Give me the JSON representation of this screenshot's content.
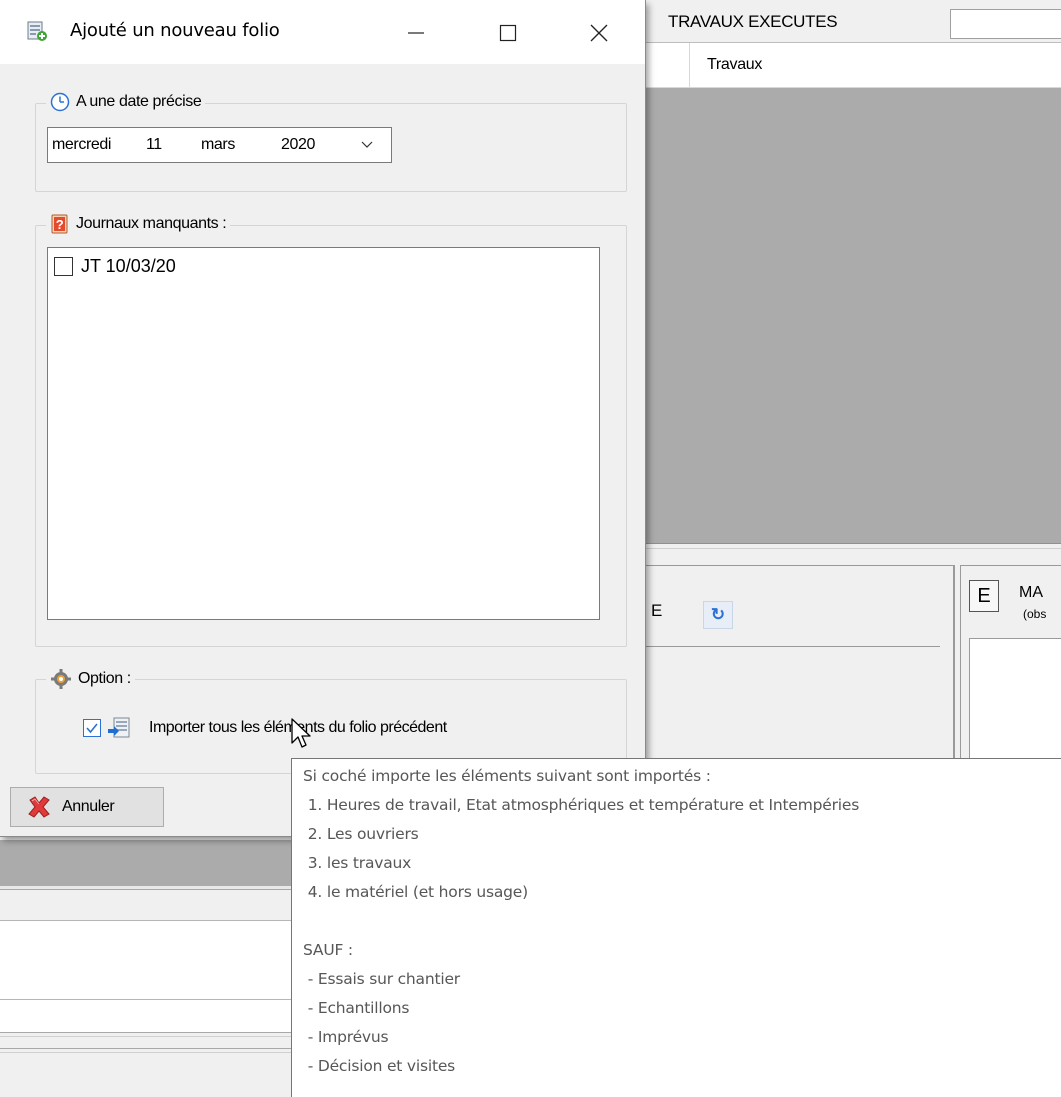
{
  "background": {
    "section_title": "TRAVAUX EXECUTES",
    "column_header": "Travaux",
    "left_panel_cut_label": "E",
    "right_panel_button": "E",
    "right_panel_title": "MA",
    "right_panel_subtitle": "(obs"
  },
  "dialog": {
    "title": "Ajouté un nouveau folio",
    "date_group": {
      "label": "A une date précise",
      "date_day": "mercredi",
      "date_num": "11",
      "date_month": "mars",
      "date_year": "2020"
    },
    "journaux_group": {
      "label": "Journaux manquants :",
      "items": [
        {
          "label": "JT 10/03/20",
          "checked": false
        }
      ]
    },
    "option_group": {
      "label": "Option :",
      "import_label": "Importer tous les éléments du folio précédent",
      "import_checked": true
    },
    "cancel_button": "Annuler"
  },
  "tooltip": {
    "lines": [
      "Si coché importe les éléments suivant sont importés :",
      " 1. Heures de travail, Etat atmosphériques et température et Intempéries",
      " 2. Les ouvriers",
      " 3. les travaux",
      " 4. le matériel (et hors usage)",
      "",
      "SAUF :",
      " - Essais sur chantier",
      " - Echantillons",
      " - Imprévus",
      " - Décision et visites"
    ]
  },
  "colors": {
    "accent": "#2d72d2",
    "window_bg": "#f0f0f0",
    "grid_grey": "#ababab"
  }
}
